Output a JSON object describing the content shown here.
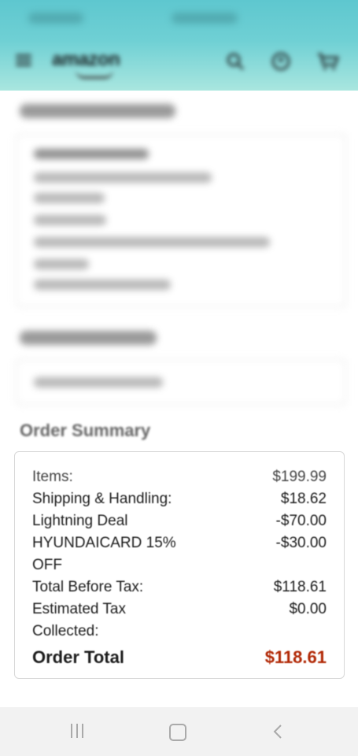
{
  "order_summary": {
    "title": "Order Summary",
    "rows": [
      {
        "label": "Items:",
        "value": "$199.99"
      },
      {
        "label": "Shipping & Handling:",
        "value": "$18.62"
      },
      {
        "label": "Lightning Deal",
        "value": "-$70.00"
      },
      {
        "label": "HYUNDAICARD 15% OFF",
        "value": "-$30.00"
      },
      {
        "label": "Total Before Tax:",
        "value": "$118.61"
      },
      {
        "label": "Estimated Tax Collected:",
        "value": "$0.00"
      }
    ],
    "total_label": "Order Total",
    "total_value": "$118.61"
  },
  "header": {
    "brand": "amazon"
  },
  "icons": {
    "menu": "menu-icon",
    "search": "search-icon",
    "account": "account-icon",
    "cart": "cart-icon",
    "recents": "recents-icon",
    "home": "home-icon",
    "back": "back-icon"
  },
  "colors": {
    "header_teal": "#5ec7cf",
    "total_red": "#b12704"
  }
}
